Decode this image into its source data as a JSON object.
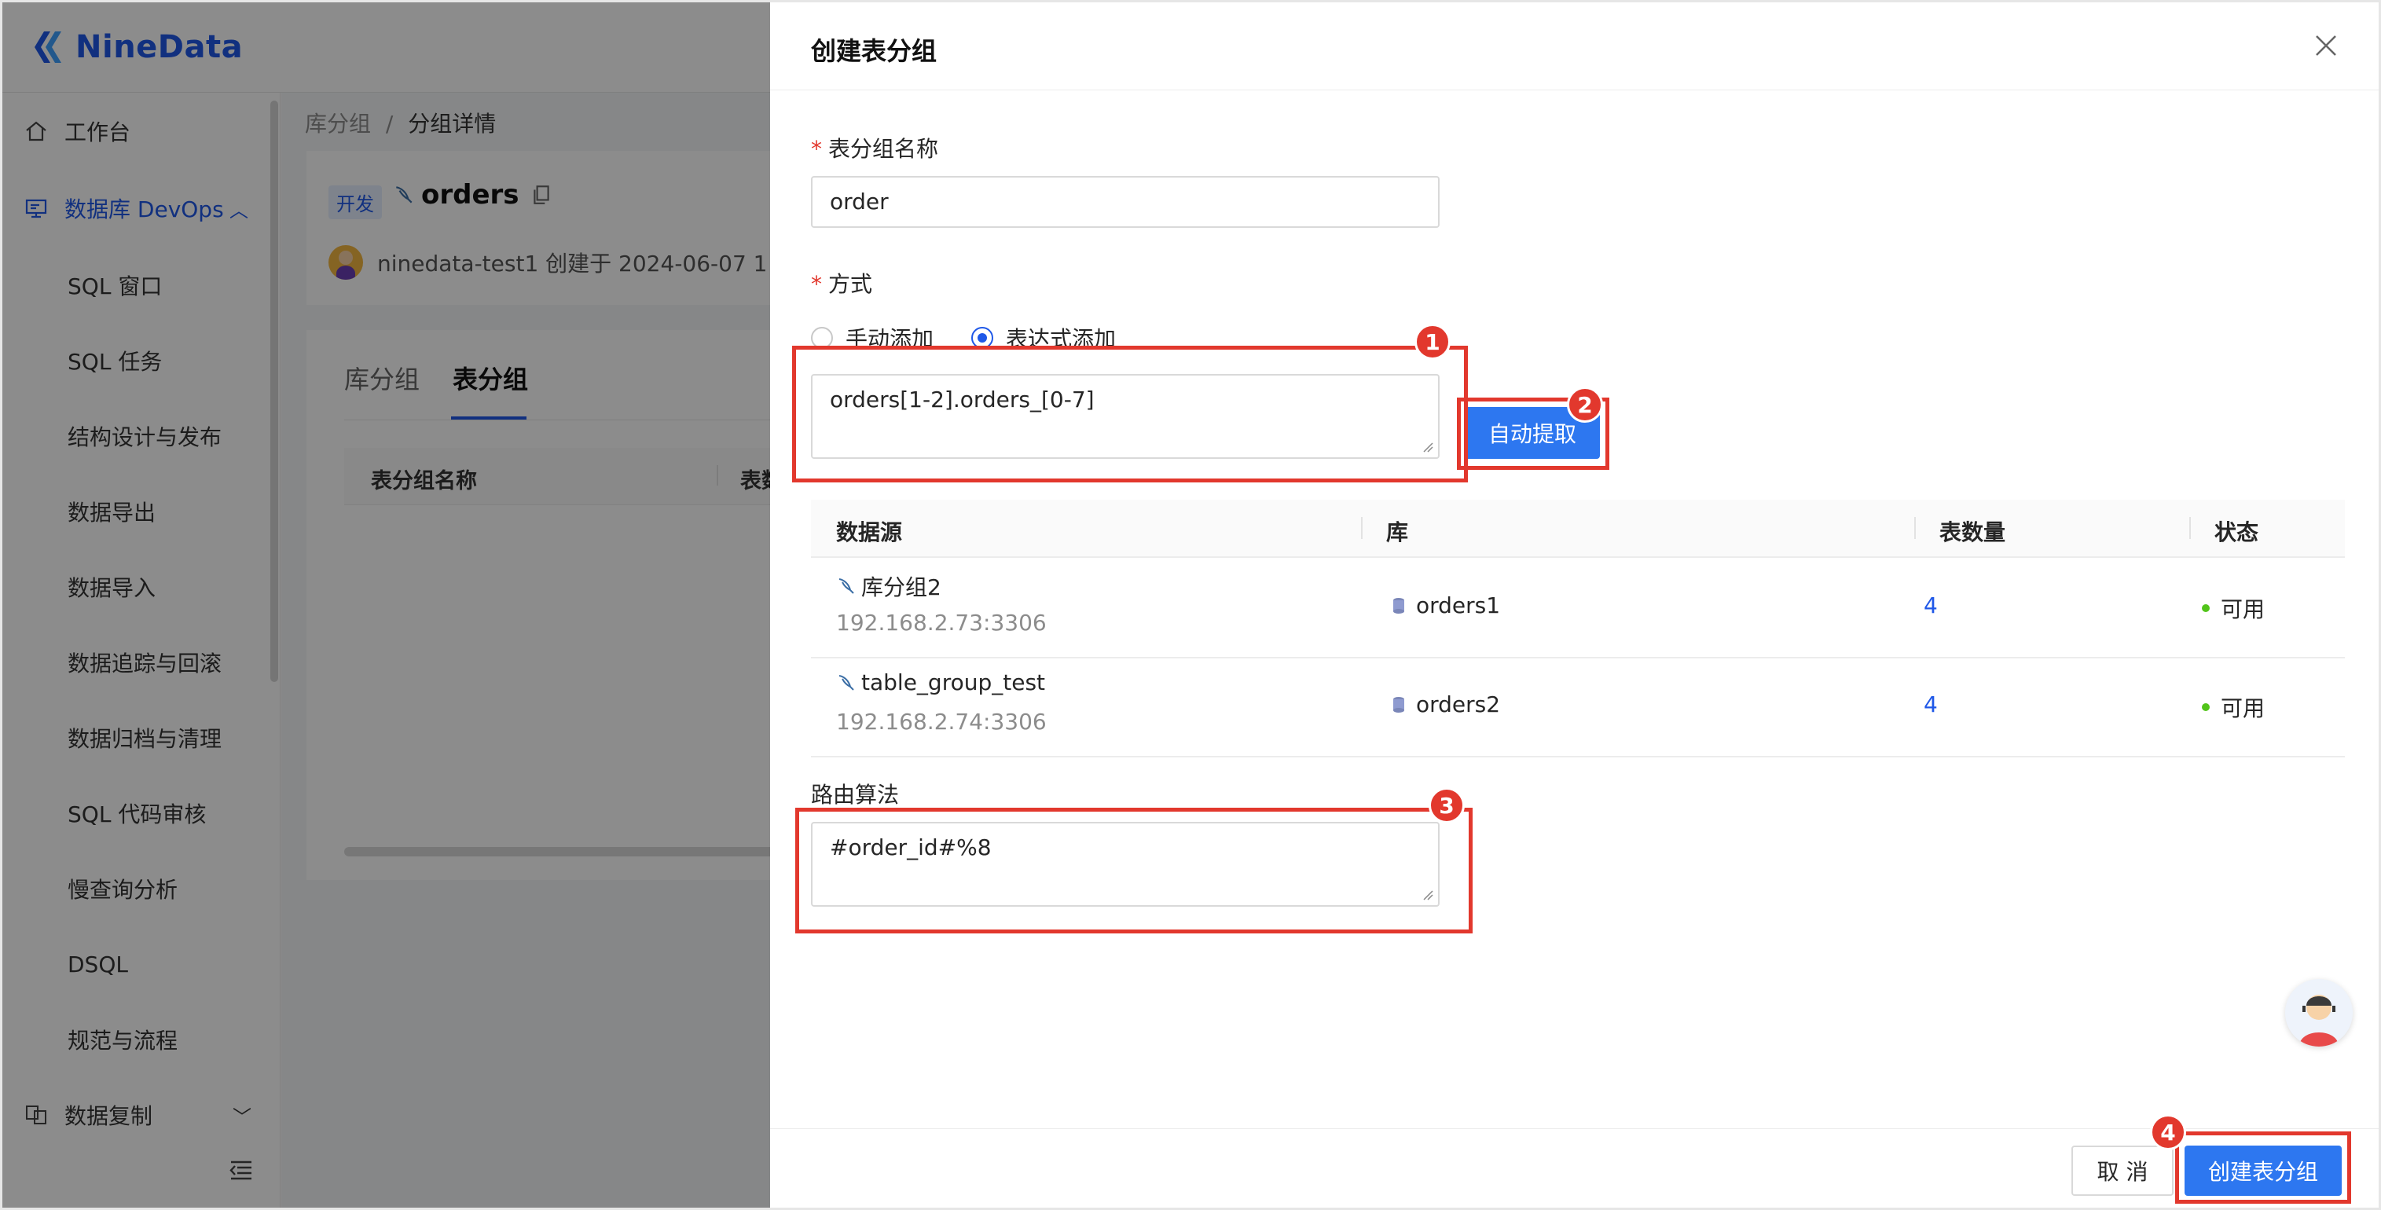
{
  "app": {
    "logo_text": "NineData"
  },
  "sidebar": {
    "items": [
      {
        "label": "工作台"
      },
      {
        "label": "数据库 DevOps"
      },
      {
        "label": "SQL 窗口"
      },
      {
        "label": "SQL 任务"
      },
      {
        "label": "结构设计与发布"
      },
      {
        "label": "数据导出"
      },
      {
        "label": "数据导入"
      },
      {
        "label": "数据追踪与回滚"
      },
      {
        "label": "数据归档与清理"
      },
      {
        "label": "SQL 代码审核"
      },
      {
        "label": "慢查询分析"
      },
      {
        "label": "DSQL"
      },
      {
        "label": "规范与流程"
      },
      {
        "label": "数据复制"
      }
    ]
  },
  "breadcrumb": {
    "parent": "库分组",
    "separator": "/",
    "current": "分组详情"
  },
  "header": {
    "env_tag": "开发",
    "title": "orders",
    "owner_line": "ninedata-test1 创建于 2024-06-07 1"
  },
  "tabs": [
    {
      "label": "库分组"
    },
    {
      "label": "表分组"
    }
  ],
  "bg_table": {
    "columns": [
      "表分组名称",
      "表数"
    ]
  },
  "drawer": {
    "title": "创建表分组",
    "name_label": "表分组名称",
    "name_value": "order",
    "mode_label": "方式",
    "mode_options": [
      "手动添加",
      "表达式添加"
    ],
    "mode_selected": "表达式添加",
    "expression_value": "orders[1-2].orders_[0-7]",
    "extract_button": "自动提取",
    "table": {
      "columns": [
        "数据源",
        "库",
        "表数量",
        "状态"
      ],
      "rows": [
        {
          "source": "库分组2",
          "address": "192.168.2.73:3306",
          "db": "orders1",
          "count": "4",
          "status": "可用"
        },
        {
          "source": "table_group_test",
          "address": "192.168.2.74:3306",
          "db": "orders2",
          "count": "4",
          "status": "可用"
        }
      ]
    },
    "routing_label": "路由算法",
    "routing_value": "#order_id#%8",
    "cancel_button": "取 消",
    "submit_button": "创建表分组"
  },
  "annotations": [
    "1",
    "2",
    "3",
    "4"
  ],
  "colors": {
    "primary": "#1f58e8",
    "button": "#2d77f0",
    "annotation_red": "#e2382d",
    "status_ok": "#52c41a"
  }
}
